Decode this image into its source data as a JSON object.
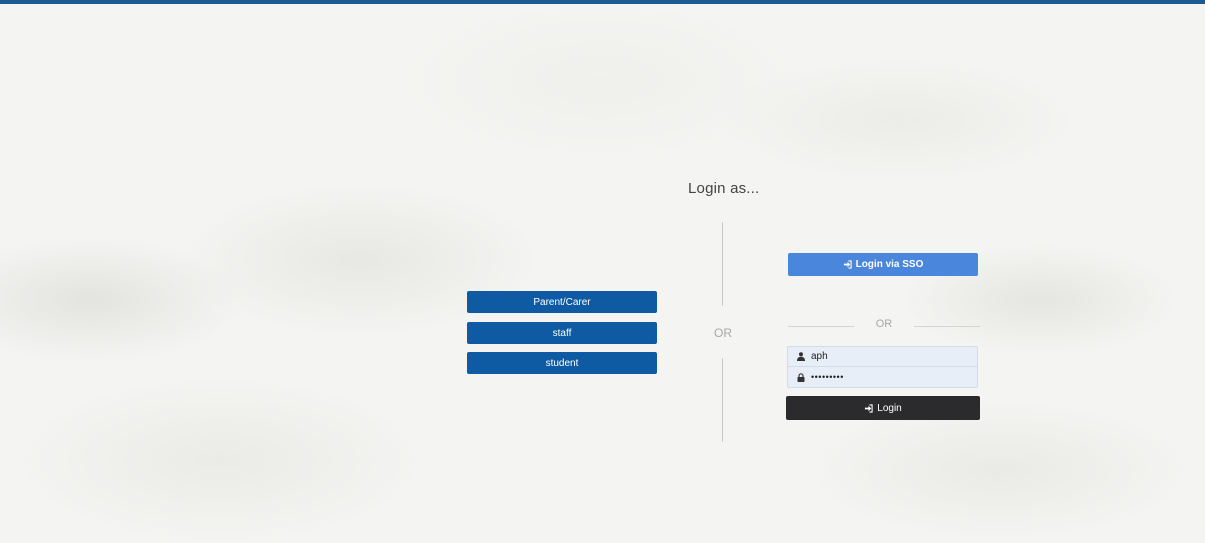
{
  "heading": "Login as...",
  "roles": {
    "parent_carer": "Parent/Carer",
    "staff": "staff",
    "student": "student"
  },
  "divider_or": "OR",
  "sso": {
    "label": "Login via SSO"
  },
  "form_divider_or": "OR",
  "form": {
    "username_value": "aph",
    "password_value": "•••••••••",
    "login_label": "Login"
  },
  "colors": {
    "top_bar": "#1d5c93",
    "role_button": "#0e5aa3",
    "sso_button": "#4a86dc",
    "login_button": "#2b2b2d",
    "input_bg": "#e7eef8"
  },
  "icons": [
    "sign-in-icon",
    "user-icon",
    "lock-icon"
  ]
}
